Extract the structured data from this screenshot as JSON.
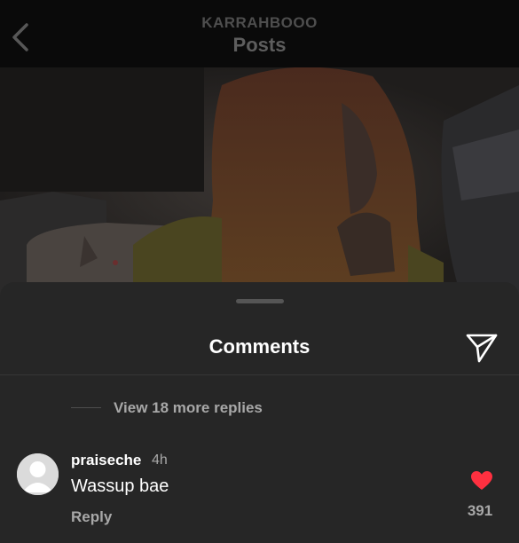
{
  "header": {
    "username": "KARRAHBOOO",
    "title": "Posts",
    "back_icon": "chevron-left-icon"
  },
  "sheet": {
    "title": "Comments",
    "send_icon": "paper-plane-icon",
    "view_more": "View 18 more replies"
  },
  "comment": {
    "username": "praiseche",
    "time": "4h",
    "text": "Wassup bae",
    "reply_label": "Reply",
    "like_icon": "heart-filled-icon",
    "likes": "391",
    "like_color": "#ff3040"
  },
  "colors": {
    "sheet_bg": "#262626",
    "secondary_text": "#a8a8a8"
  }
}
